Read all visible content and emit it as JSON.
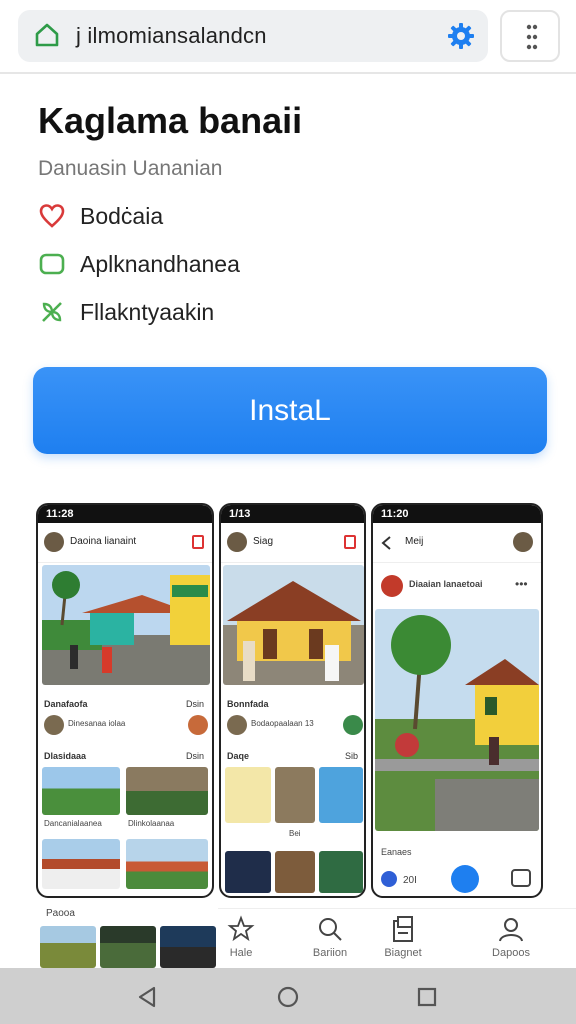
{
  "browser": {
    "url": "j ilmomiansalandcn"
  },
  "app": {
    "title": "Kaglama banaii",
    "subtitle": "Danuasin Uananian",
    "features": [
      {
        "icon": "heart-icon",
        "label": "Bodċaia",
        "color": "#d93a3a"
      },
      {
        "icon": "rounded-square-icon",
        "label": "Aplknandhanea",
        "color": "#4caf50"
      },
      {
        "icon": "leaf-cross-icon",
        "label": "Fllakntyaakin",
        "color": "#4caf50"
      }
    ],
    "install_label": "InstaL",
    "accent": "#1e7ff0"
  },
  "screens": {
    "phone1": {
      "time": "11:28",
      "header": "Daoina lianaint",
      "section1": "Danafaofa",
      "section1_right": "Dsin",
      "row_text": "Dinesanaa iolaa",
      "section2": "Dlasidaaa",
      "section2_right": "Dsin",
      "caption1": "Dancanialaanea",
      "caption2": "Dlinkolaanaa"
    },
    "phone2": {
      "time": "1/13",
      "header": "Siag",
      "section1": "Bonnfada",
      "row_text": "Bodaopaalaan  13",
      "section2": "Daqe",
      "section2_right": "Sib",
      "caption1": "Bei"
    },
    "phone3": {
      "time": "11:20",
      "header": "Meij",
      "post_title": "Diaaian lanaetoai",
      "footer_label": "Eanaes",
      "footer_count": "20I"
    },
    "left_label": "Paooa"
  },
  "bottom_nav": [
    {
      "icon": "home-icon",
      "label": "Hale"
    },
    {
      "icon": "search-icon",
      "label": "Bariion"
    },
    {
      "icon": "library-icon",
      "label": "Biagnet"
    },
    {
      "icon": "profile-icon",
      "label": "Dapoos"
    }
  ]
}
